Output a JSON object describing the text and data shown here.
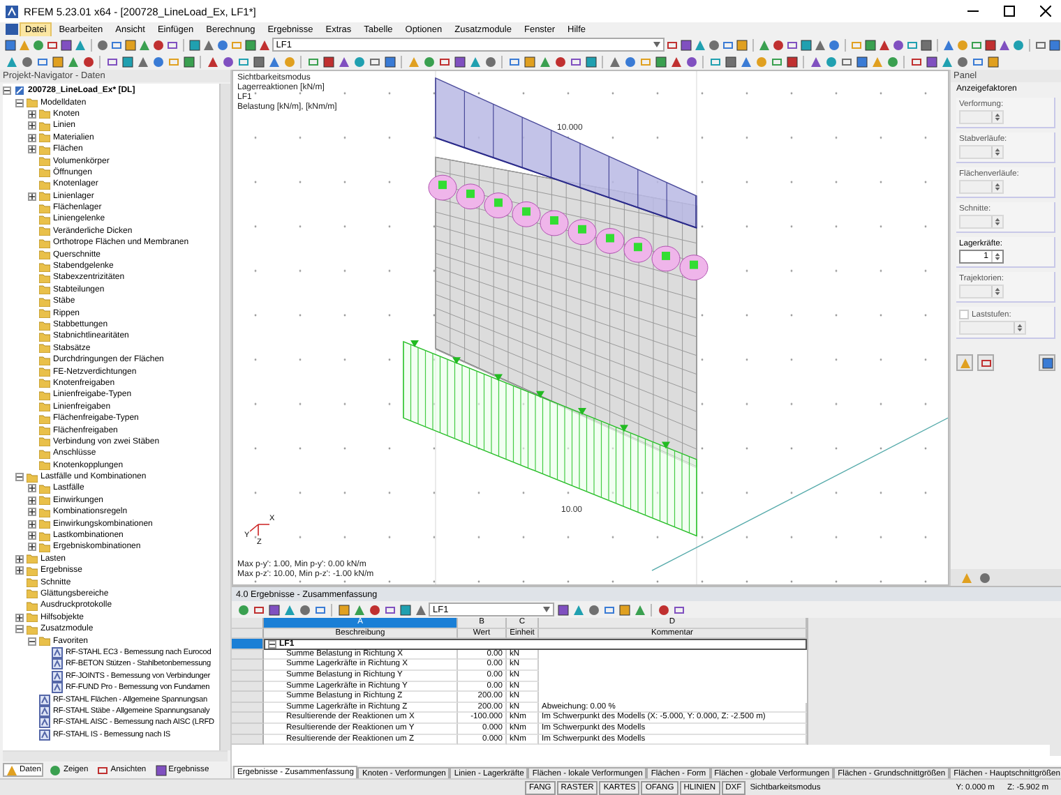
{
  "window": {
    "title": "RFEM 5.23.01 x64 - [200728_LineLoad_Ex, LF1*]"
  },
  "menu": [
    {
      "label": "Datei",
      "selected": true
    },
    {
      "label": "Bearbeiten",
      "selected": false
    },
    {
      "label": "Ansicht",
      "selected": false
    },
    {
      "label": "Einfügen",
      "selected": false
    },
    {
      "label": "Berechnung",
      "selected": false
    },
    {
      "label": "Ergebnisse",
      "selected": false
    },
    {
      "label": "Extras",
      "selected": false
    },
    {
      "label": "Tabelle",
      "selected": false
    },
    {
      "label": "Optionen",
      "selected": false
    },
    {
      "label": "Zusatzmodule",
      "selected": false
    },
    {
      "label": "Fenster",
      "selected": false
    },
    {
      "label": "Hilfe",
      "selected": false
    }
  ],
  "toolbar": {
    "load_case": "LF1"
  },
  "navigator": {
    "title": "Projekt-Navigator - Daten",
    "tree": [
      {
        "label": "200728_LineLoad_Ex* [DL]",
        "kind": "project",
        "expanded": true,
        "children": [
          {
            "label": "Modelldaten",
            "expanded": true,
            "children": [
              {
                "label": "Knoten",
                "expanded": false
              },
              {
                "label": "Linien",
                "expanded": false
              },
              {
                "label": "Materialien",
                "expanded": false
              },
              {
                "label": "Flächen",
                "expanded": false
              },
              {
                "label": "Volumenkörper"
              },
              {
                "label": "Öffnungen"
              },
              {
                "label": "Knotenlager"
              },
              {
                "label": "Linienlager",
                "expanded": false
              },
              {
                "label": "Flächenlager"
              },
              {
                "label": "Liniengelenke"
              },
              {
                "label": "Veränderliche Dicken"
              },
              {
                "label": "Orthotrope Flächen und Membranen"
              },
              {
                "label": "Querschnitte"
              },
              {
                "label": "Stabendgelenke"
              },
              {
                "label": "Stabexzentrizitäten"
              },
              {
                "label": "Stabteilungen"
              },
              {
                "label": "Stäbe"
              },
              {
                "label": "Rippen"
              },
              {
                "label": "Stabbettungen"
              },
              {
                "label": "Stabnichtlinearitäten"
              },
              {
                "label": "Stabsätze"
              },
              {
                "label": "Durchdringungen der Flächen"
              },
              {
                "label": "FE-Netzverdichtungen"
              },
              {
                "label": "Knotenfreigaben"
              },
              {
                "label": "Linienfreigabe-Typen"
              },
              {
                "label": "Linienfreigaben"
              },
              {
                "label": "Flächenfreigabe-Typen"
              },
              {
                "label": "Flächenfreigaben"
              },
              {
                "label": "Verbindung von zwei Stäben"
              },
              {
                "label": "Anschlüsse"
              },
              {
                "label": "Knotenkopplungen"
              }
            ]
          },
          {
            "label": "Lastfälle und Kombinationen",
            "expanded": true,
            "children": [
              {
                "label": "Lastfälle",
                "expanded": false
              },
              {
                "label": "Einwirkungen",
                "expanded": false
              },
              {
                "label": "Kombinationsregeln",
                "expanded": false
              },
              {
                "label": "Einwirkungskombinationen",
                "expanded": false
              },
              {
                "label": "Lastkombinationen",
                "expanded": false
              },
              {
                "label": "Ergebniskombinationen",
                "expanded": false
              }
            ]
          },
          {
            "label": "Lasten",
            "expanded": false
          },
          {
            "label": "Ergebnisse",
            "expanded": false
          },
          {
            "label": "Schnitte"
          },
          {
            "label": "Glättungsbereiche"
          },
          {
            "label": "Ausdruckprotokolle"
          },
          {
            "label": "Hilfsobjekte",
            "expanded": false
          },
          {
            "label": "Zusatzmodule",
            "expanded": true,
            "children": [
              {
                "label": "Favoriten",
                "kind": "folder",
                "expanded": true,
                "children": [
                  {
                    "label": "RF-STAHL EC3 - Bemessung nach Eurocod",
                    "kind": "module"
                  },
                  {
                    "label": "RF-BETON Stützen - Stahlbetonbemessung",
                    "kind": "module"
                  },
                  {
                    "label": "RF-JOINTS - Bemessung von Verbindunger",
                    "kind": "module"
                  },
                  {
                    "label": "RF-FUND Pro - Bemessung von Fundamen",
                    "kind": "module"
                  }
                ]
              },
              {
                "label": "RF-STAHL Flächen - Allgemeine Spannungsan",
                "kind": "module"
              },
              {
                "label": "RF-STAHL Stäbe - Allgemeine Spannungsanaly",
                "kind": "module"
              },
              {
                "label": "RF-STAHL AISC - Bemessung nach AISC (LRFD",
                "kind": "module"
              },
              {
                "label": "RF-STAHL IS - Bemessung nach IS",
                "kind": "module"
              }
            ]
          }
        ]
      }
    ],
    "tabs": [
      {
        "label": "Daten",
        "selected": true
      },
      {
        "label": "Zeigen",
        "selected": false
      },
      {
        "label": "Ansichten",
        "selected": false
      },
      {
        "label": "Ergebnisse",
        "selected": false
      }
    ]
  },
  "viewport": {
    "info": [
      "Sichtbarkeitsmodus",
      "Lagerreaktionen [kN/m]",
      "LF1",
      "Belastung [kN/m], [kNm/m]"
    ],
    "extremes": [
      "Max p-y': 1.00, Min p-y': 0.00 kN/m",
      "Max p-z': 10.00, Min p-z': -1.00 kN/m"
    ],
    "load_labels": [
      "10.000",
      "10.00"
    ],
    "axes": [
      "X",
      "Y",
      "Z"
    ]
  },
  "panel": {
    "title": "Panel",
    "group": "Anzeigefaktoren",
    "fields": [
      {
        "label": "Verformung:",
        "kind": "spinner",
        "disabled": true
      },
      {
        "label": "Stabverläufe:",
        "kind": "spinner",
        "disabled": true
      },
      {
        "label": "Flächenverläufe:",
        "kind": "spinner",
        "disabled": true
      },
      {
        "label": "Schnitte:",
        "kind": "spinner",
        "disabled": true
      },
      {
        "label": "Lagerkräfte:",
        "kind": "spinner",
        "disabled": false,
        "value": "1"
      },
      {
        "label": "Trajektorien:",
        "kind": "spinner",
        "disabled": true
      },
      {
        "label": "Laststufen:",
        "kind": "checkbox",
        "disabled": true,
        "checked": false
      }
    ]
  },
  "results": {
    "title": "4.0 Ergebnisse - Zusammenfassung",
    "load_case": "LF1",
    "columns": [
      {
        "letter": "A",
        "name": "Beschreibung"
      },
      {
        "letter": "B",
        "name": "Wert"
      },
      {
        "letter": "C",
        "name": "Einheit"
      },
      {
        "letter": "D",
        "name": "Kommentar"
      }
    ],
    "group": {
      "label": "LF1",
      "expanded": true
    },
    "rows": [
      {
        "description": "Summe Belastung in Richtung X",
        "value": "0.00",
        "unit": "kN"
      },
      {
        "description": "Summe Lagerkräfte in Richtung X",
        "value": "0.00",
        "unit": "kN"
      },
      {
        "description": "Summe Belastung in Richtung Y",
        "value": "0.00",
        "unit": "kN"
      },
      {
        "description": "Summe Lagerkräfte in Richtung Y",
        "value": "0.00",
        "unit": "kN"
      },
      {
        "description": "Summe Belastung in Richtung Z",
        "value": "200.00",
        "unit": "kN"
      },
      {
        "description": "Summe Lagerkräfte in Richtung Z",
        "value": "200.00",
        "unit": "kN",
        "comment": "Abweichung:  0.00 %"
      },
      {
        "description": "Resultierende der Reaktionen um X",
        "value": "-100.000",
        "unit": "kNm",
        "comment": "Im Schwerpunkt des Modells (X: -5.000, Y: 0.000, Z: -2.500 m)"
      },
      {
        "description": "Resultierende der Reaktionen um Y",
        "value": "0.000",
        "unit": "kNm",
        "comment": "Im Schwerpunkt des Modells"
      },
      {
        "description": "Resultierende der Reaktionen um Z",
        "value": "0.000",
        "unit": "kNm",
        "comment": "Im Schwerpunkt des Modells"
      }
    ],
    "tabs": [
      {
        "label": "Ergebnisse - Zusammenfassung",
        "selected": true
      },
      {
        "label": "Knoten - Verformungen",
        "selected": false
      },
      {
        "label": "Linien - Lagerkräfte",
        "selected": false
      },
      {
        "label": "Flächen - lokale Verformungen",
        "selected": false
      },
      {
        "label": "Flächen - Form",
        "selected": false
      },
      {
        "label": "Flächen - globale Verformungen",
        "selected": false
      },
      {
        "label": "Flächen - Grundschnittgrößen",
        "selected": false
      },
      {
        "label": "Flächen - Hauptschnittgrößen",
        "selected": false
      }
    ]
  },
  "status_bar": {
    "toggles": [
      "FANG",
      "RASTER",
      "KARTES",
      "OFANG",
      "HLINIEN",
      "DXF"
    ],
    "mode": "Sichtbarkeitsmodus",
    "y": "Y: 0.000 m",
    "z": "Z: -5.902 m"
  }
}
